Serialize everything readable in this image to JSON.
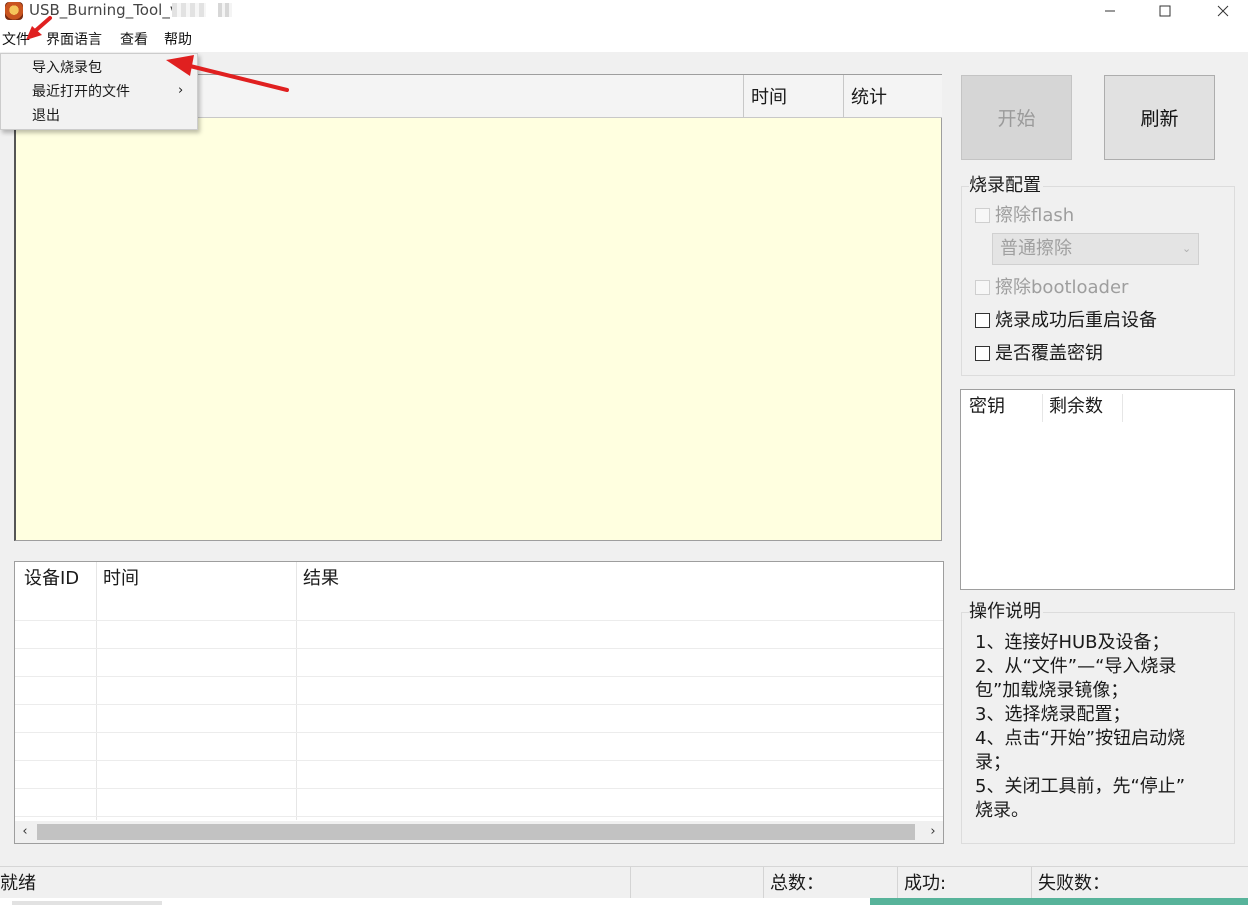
{
  "window": {
    "title": "USB_Burning_Tool_v",
    "controls": {
      "minimize": "—",
      "maximize": "☐",
      "close": "✕"
    }
  },
  "menubar": {
    "items": [
      "文件",
      "界面语言",
      "查看",
      "帮助"
    ]
  },
  "file_menu": {
    "items": [
      "导入烧录包",
      "最近打开的文件",
      "退出"
    ],
    "submenu_arrow": "›"
  },
  "device_list": {
    "columns": [
      "时间",
      "统计"
    ]
  },
  "log_table": {
    "columns": [
      "设备ID",
      "时间",
      "结果"
    ],
    "rows": [],
    "scroll_left": "‹",
    "scroll_right": "›"
  },
  "buttons": {
    "start": "开始",
    "refresh": "刷新"
  },
  "burn_config": {
    "title": "烧录配置",
    "erase_flash": {
      "label": "擦除flash",
      "checked": false,
      "enabled": false
    },
    "erase_mode": {
      "value": "普通擦除",
      "enabled": false,
      "arrow": "⌄"
    },
    "erase_bootloader": {
      "label": "擦除bootloader",
      "checked": false,
      "enabled": false
    },
    "reboot_after_burn": {
      "label": "烧录成功后重启设备",
      "checked": false,
      "enabled": true
    },
    "overwrite_key": {
      "label": "是否覆盖密钥",
      "checked": false,
      "enabled": true
    }
  },
  "key_list": {
    "columns": [
      "密钥",
      "剩余数"
    ]
  },
  "instructions": {
    "title": "操作说明",
    "lines": [
      "1、连接好HUB及设备；",
      "2、从“文件”—“导入烧录",
      "包”加载烧录镜像；",
      "3、选择烧录配置；",
      "4、点击“开始”按钮启动烧",
      "录；",
      "5、关闭工具前，先“停止”",
      "烧录。"
    ]
  },
  "statusbar": {
    "status": "就绪",
    "total_label": "总数：",
    "success_label": "成功:",
    "fail_label": "失败数："
  },
  "colors": {
    "list_background": "#ffffe0",
    "annotation_arrow": "#e02020",
    "window_background": "#f0f0f0"
  }
}
